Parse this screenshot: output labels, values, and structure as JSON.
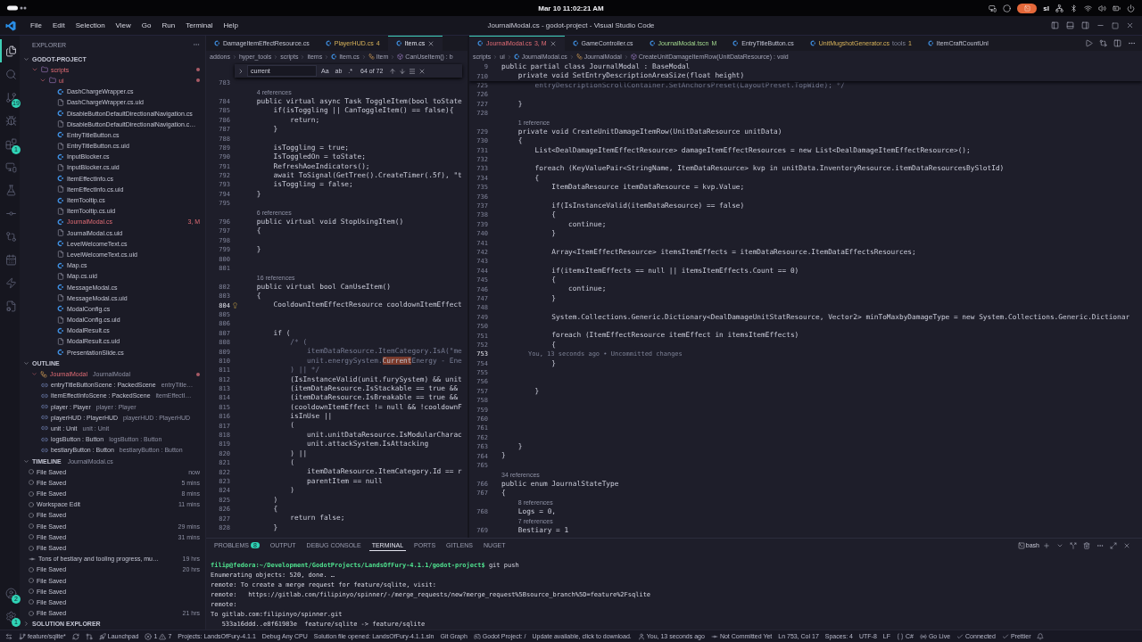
{
  "system_bar": {
    "datetime": "Mar 10  11:02:21 AM",
    "user": "sl"
  },
  "title_bar": {
    "menus": [
      "File",
      "Edit",
      "Selection",
      "View",
      "Go",
      "Run",
      "Terminal",
      "Help"
    ],
    "title": "JournalModal.cs - godot-project - Visual Studio Code"
  },
  "activity_bar": {
    "items": [
      {
        "selected": true
      },
      {
        "selected": false
      },
      {
        "selected": false,
        "badge": "19"
      },
      {
        "selected": false
      },
      {
        "selected": false,
        "badge": "1"
      },
      {
        "selected": false
      },
      {
        "selected": false
      },
      {
        "selected": false
      },
      {
        "selected": false
      },
      {
        "selected": false
      },
      {
        "selected": false
      },
      {
        "selected": false
      }
    ],
    "bottom": [
      {
        "badge": "2"
      },
      {
        "badge": "1"
      }
    ]
  },
  "sidebar": {
    "explorer": {
      "title": "EXPLORER",
      "project": "GODOT-PROJECT",
      "tree": [
        {
          "name": "scripts",
          "kind": "folder",
          "errored": true,
          "expanded": true,
          "children": [
            {
              "name": "ui",
              "kind": "folder",
              "errored": true,
              "expanded": true,
              "children": [
                {
                  "name": "DashChargeWrapper.cs",
                  "kind": "cs",
                  "errored": false
                },
                {
                  "name": "DashChargeWrapper.cs.uid",
                  "kind": "file",
                  "errored": false
                },
                {
                  "name": "DisableButtonDefaultDirectionalNavigation.cs",
                  "kind": "cs",
                  "errored": false
                },
                {
                  "name": "DisableButtonDefaultDirectionalNavigation.c…",
                  "kind": "file",
                  "errored": false
                },
                {
                  "name": "EntryTitleButton.cs",
                  "kind": "cs",
                  "errored": false
                },
                {
                  "name": "EntryTitleButton.cs.uid",
                  "kind": "file",
                  "errored": false
                },
                {
                  "name": "InputBlocker.cs",
                  "kind": "cs",
                  "errored": false
                },
                {
                  "name": "InputBlocker.cs.uid",
                  "kind": "file",
                  "errored": false
                },
                {
                  "name": "ItemEffectInfo.cs",
                  "kind": "cs",
                  "errored": false
                },
                {
                  "name": "ItemEffectInfo.cs.uid",
                  "kind": "file",
                  "errored": false
                },
                {
                  "name": "ItemTooltip.cs",
                  "kind": "cs",
                  "errored": false
                },
                {
                  "name": "ItemTooltip.cs.uid",
                  "kind": "file",
                  "errored": false
                },
                {
                  "name": "JournalModal.cs",
                  "kind": "cs",
                  "errored": true,
                  "badge": "3, M"
                },
                {
                  "name": "JournalModal.cs.uid",
                  "kind": "file",
                  "errored": false
                },
                {
                  "name": "LevelWelcomeText.cs",
                  "kind": "cs",
                  "errored": false
                },
                {
                  "name": "LevelWelcomeText.cs.uid",
                  "kind": "file",
                  "errored": false
                },
                {
                  "name": "Map.cs",
                  "kind": "cs",
                  "errored": false
                },
                {
                  "name": "Map.cs.uid",
                  "kind": "file",
                  "errored": false
                },
                {
                  "name": "MessageModal.cs",
                  "kind": "cs",
                  "errored": false
                },
                {
                  "name": "MessageModal.cs.uid",
                  "kind": "file",
                  "errored": false
                },
                {
                  "name": "ModalConfig.cs",
                  "kind": "cs",
                  "errored": false
                },
                {
                  "name": "ModalConfig.cs.uid",
                  "kind": "file",
                  "errored": false
                },
                {
                  "name": "ModalResult.cs",
                  "kind": "cs",
                  "errored": false
                },
                {
                  "name": "ModalResult.cs.uid",
                  "kind": "file",
                  "errored": false
                },
                {
                  "name": "PresentationSlide.cs",
                  "kind": "cs",
                  "errored": false
                }
              ]
            }
          ]
        }
      ]
    },
    "outline": {
      "title": "OUTLINE",
      "expanded": true,
      "root": {
        "name": "JournalModal",
        "detail": "JournalModal",
        "expanded": true,
        "children": [
          {
            "name": "entryTitleButtonScene : PackedScene",
            "detail": "entryTitle…"
          },
          {
            "name": "itemEffectInfoScene : PackedScene",
            "detail": "itemEffectI…"
          },
          {
            "name": "player : Player",
            "detail": "player : Player"
          },
          {
            "name": "playerHUD : PlayerHUD",
            "detail": "playerHUD : PlayerHUD"
          },
          {
            "name": "unit : Unit",
            "detail": "unit : Unit"
          },
          {
            "name": "logsButton : Button",
            "detail": "logsButton : Button"
          },
          {
            "name": "bestiaryButton : Button",
            "detail": "bestiaryButton : Button"
          }
        ]
      }
    },
    "timeline": {
      "title": "TIMELINE",
      "file": "JournalModal.cs",
      "expanded": true,
      "entries": [
        {
          "label": "File Saved",
          "time": "now",
          "kind": "save"
        },
        {
          "label": "File Saved",
          "time": "5 mins",
          "kind": "save"
        },
        {
          "label": "File Saved",
          "time": "8 mins",
          "kind": "save"
        },
        {
          "label": "Workspace Edit",
          "time": "11 mins",
          "kind": "save"
        },
        {
          "label": "File Saved",
          "kind": "save"
        },
        {
          "label": "File Saved",
          "time": "29 mins",
          "kind": "save"
        },
        {
          "label": "File Saved",
          "time": "31 mins",
          "kind": "save"
        },
        {
          "label": "File Saved",
          "kind": "save"
        },
        {
          "label": "Tons of bestiary and tooling progress, mu…",
          "time": "19 hrs",
          "kind": "commit"
        },
        {
          "label": "File Saved",
          "time": "20 hrs",
          "kind": "save"
        },
        {
          "label": "File Saved",
          "kind": "save"
        },
        {
          "label": "File Saved",
          "kind": "save"
        },
        {
          "label": "File Saved",
          "kind": "save"
        },
        {
          "label": "File Saved",
          "time": "21 hrs",
          "kind": "save"
        }
      ]
    },
    "solution_explorer": {
      "title": "SOLUTION EXPLORER",
      "expanded": false
    }
  },
  "editors": [
    {
      "tabs": [
        {
          "label": "DamageItemEffectResource.cs",
          "kind": "plain",
          "selected": false
        },
        {
          "label": "PlayerHUD.cs",
          "badge": "4",
          "kind": "warning",
          "selected": false
        },
        {
          "label": "Item.cs",
          "kind": "plain",
          "selected": true
        }
      ],
      "breadcrumb": [
        {
          "text": "addons",
          "kind": "folder"
        },
        {
          "text": "hyper_tools",
          "kind": "folder"
        },
        {
          "text": "scripts",
          "kind": "folder"
        },
        {
          "text": "items",
          "kind": "folder"
        },
        {
          "text": "Item.cs",
          "kind": "cs"
        },
        {
          "text": "Item",
          "kind": "class"
        },
        {
          "text": "CanUseItem() : b",
          "kind": "method"
        }
      ],
      "find": {
        "value": "current",
        "options": [
          "Aa",
          "ab",
          ".*"
        ],
        "count": "64 of 72"
      },
      "lines": [
        {
          "n": "783",
          "current": false
        },
        {
          "n": "784",
          "text": "    public virtual async Task ToggleItem(bool toState",
          "kind": "code",
          "current": false,
          "refs": "4 references"
        },
        {
          "n": "785",
          "text": "        if(isToggling || CanToggleItem() == false){",
          "kind": "code",
          "current": false
        },
        {
          "n": "786",
          "text": "            return;",
          "kind": "code",
          "current": false
        },
        {
          "n": "787",
          "text": "        }",
          "kind": "code",
          "current": false
        },
        {
          "n": "788",
          "current": false
        },
        {
          "n": "789",
          "text": "        isToggling = true;",
          "kind": "code",
          "current": false
        },
        {
          "n": "790",
          "text": "        IsToggledOn = toState;",
          "kind": "code",
          "current": false
        },
        {
          "n": "791",
          "text": "        RefreshAoeIndicators();",
          "kind": "code",
          "current": false
        },
        {
          "n": "792",
          "text": "        await ToSignal(GetTree().CreateTimer(.5f), \"t",
          "kind": "code",
          "current": false
        },
        {
          "n": "793",
          "text": "        isToggling = false;",
          "kind": "code",
          "current": false
        },
        {
          "n": "794",
          "text": "    }",
          "kind": "code",
          "current": false
        },
        {
          "n": "795",
          "current": false
        },
        {
          "n": "796",
          "text": "    public virtual void StopUsingItem()",
          "kind": "code",
          "current": false,
          "refs": "6 references"
        },
        {
          "n": "797",
          "text": "    {",
          "kind": "code",
          "current": false
        },
        {
          "n": "798",
          "current": false
        },
        {
          "n": "799",
          "text": "    }",
          "kind": "code",
          "current": false
        },
        {
          "n": "800",
          "current": false
        },
        {
          "n": "801",
          "current": false
        },
        {
          "n": "802",
          "text": "    public virtual bool CanUseItem()",
          "kind": "code",
          "current": false,
          "refs": "16 references"
        },
        {
          "n": "803",
          "text": "    {",
          "kind": "code",
          "current": false
        },
        {
          "n": "804",
          "text": "        CooldownItemEffectResource cooldownItemEffect",
          "kind": "code",
          "current": true,
          "quick_fix": true
        },
        {
          "n": "805",
          "current": false
        },
        {
          "n": "806",
          "current": false
        },
        {
          "n": "807",
          "text": "        if (",
          "kind": "code",
          "current": false
        },
        {
          "n": "808",
          "text": "            /* (",
          "kind": "comment",
          "current": false
        },
        {
          "n": "809",
          "text": "                itemDataResource.ItemCategory.IsA(\"me",
          "kind": "comment",
          "current": false
        },
        {
          "n": "810",
          "text": "                unit.energySystem.",
          "match": "Current",
          "after": "Energy - Ene",
          "kind": "comment",
          "current": false
        },
        {
          "n": "811",
          "text": "            ) || */",
          "kind": "comment",
          "current": false
        },
        {
          "n": "812",
          "text": "            (IsInstanceValid(unit.furySystem) && unit",
          "kind": "code",
          "current": false
        },
        {
          "n": "813",
          "text": "            (itemDataResource.IsStackable == true &&",
          "kind": "code",
          "current": false
        },
        {
          "n": "814",
          "text": "            (itemDataResource.IsBreakable == true &&",
          "kind": "code",
          "current": false
        },
        {
          "n": "815",
          "text": "            (cooldownItemEffect != null && !cooldownF",
          "kind": "code",
          "current": false
        },
        {
          "n": "816",
          "text": "            isInUse ||",
          "kind": "code",
          "current": false
        },
        {
          "n": "817",
          "text": "            (",
          "kind": "code",
          "current": false
        },
        {
          "n": "818",
          "text": "                unit.unitDataResource.IsModularCharac",
          "kind": "code",
          "current": false
        },
        {
          "n": "819",
          "text": "                unit.attackSystem.IsAttacking",
          "kind": "code",
          "current": false
        },
        {
          "n": "820",
          "text": "            ) ||",
          "kind": "code",
          "current": false
        },
        {
          "n": "821",
          "text": "            (",
          "kind": "code",
          "current": false
        },
        {
          "n": "822",
          "text": "                itemDataResource.ItemCategory.Id == r",
          "kind": "code",
          "current": false
        },
        {
          "n": "823",
          "text": "                parentItem == null",
          "kind": "code",
          "current": false
        },
        {
          "n": "824",
          "text": "            )",
          "kind": "code",
          "current": false
        },
        {
          "n": "825",
          "text": "        )",
          "kind": "code",
          "current": false
        },
        {
          "n": "826",
          "text": "        {",
          "kind": "code",
          "current": false
        },
        {
          "n": "827",
          "text": "            return false;",
          "kind": "code",
          "current": false
        },
        {
          "n": "828",
          "text": "        }",
          "kind": "code",
          "current": false
        }
      ]
    },
    {
      "tabs": [
        {
          "label": "JournalModal.cs",
          "badge": "3, M",
          "kind": "error",
          "selected": true
        },
        {
          "label": "GameController.cs",
          "kind": "plain",
          "selected": false
        },
        {
          "label": "JournalModal.tscn",
          "badge": "M",
          "kind": "modified",
          "selected": false
        },
        {
          "label": "EntryTitleButton.cs",
          "kind": "plain",
          "selected": false
        },
        {
          "label": "UnitMugshotGenerator.cs",
          "detail": "tools",
          "badge": "1",
          "kind": "warning",
          "selected": false
        },
        {
          "label": "ItemCraftCountUnl",
          "kind": "plain",
          "selected": false
        }
      ],
      "breadcrumb": [
        {
          "text": "scripts",
          "kind": "folder"
        },
        {
          "text": "ui",
          "kind": "folder"
        },
        {
          "text": "JournalModal.cs",
          "kind": "cs"
        },
        {
          "text": "JournalModal",
          "kind": "class"
        },
        {
          "text": "CreateUnitDamageItemRow(UnitDataResource) : void",
          "kind": "method"
        }
      ],
      "sticky": [
        {
          "n": "9",
          "text": "public partial class JournalModal : BaseModal"
        },
        {
          "n": "710",
          "text": "    private void SetEntryDescriptionAreaSize(float height)"
        }
      ],
      "lines": [
        {
          "n": "725",
          "text": "        entryDescriptionScrollContainer.SetAnchorsPreset(LayoutPreset.TopWide); */",
          "kind": "comment",
          "current": false
        },
        {
          "n": "726",
          "current": false
        },
        {
          "n": "727",
          "text": "    }",
          "kind": "code",
          "current": false
        },
        {
          "n": "728",
          "current": false
        },
        {
          "n": "729",
          "text": "    private void CreateUnitDamageItemRow(UnitDataResource unitData)",
          "kind": "code",
          "current": false,
          "refs": "1 reference"
        },
        {
          "n": "730",
          "text": "    {",
          "kind": "code",
          "current": false
        },
        {
          "n": "731",
          "text": "        List<DealDamageItemEffectResource> damageItemEffectResources = new List<DealDamageItemEffectResource>();",
          "kind": "code",
          "current": false
        },
        {
          "n": "732",
          "current": false
        },
        {
          "n": "733",
          "text": "        foreach (KeyValuePair<StringName, ItemDataResource> kvp in unitData.InventoryResource.itemDataResourcesBySlotId)",
          "kind": "code",
          "current": false
        },
        {
          "n": "734",
          "text": "        {",
          "kind": "code",
          "current": false
        },
        {
          "n": "735",
          "text": "            ItemDataResource itemDataResource = kvp.Value;",
          "kind": "code",
          "current": false
        },
        {
          "n": "736",
          "current": false
        },
        {
          "n": "737",
          "text": "            if(IsInstanceValid(itemDataResource) == false)",
          "kind": "code",
          "current": false
        },
        {
          "n": "738",
          "text": "            {",
          "kind": "code",
          "current": false
        },
        {
          "n": "739",
          "text": "                continue;",
          "kind": "code",
          "current": false
        },
        {
          "n": "740",
          "text": "            }",
          "kind": "code",
          "current": false
        },
        {
          "n": "741",
          "current": false
        },
        {
          "n": "742",
          "text": "            Array<ItemEffectResource> itemsItemEffects = itemDataResource.ItemDataEffectsResources;",
          "kind": "code",
          "current": false
        },
        {
          "n": "743",
          "current": false
        },
        {
          "n": "744",
          "text": "            if(itemsItemEffects == null || itemsItemEffects.Count == 0)",
          "kind": "code",
          "current": false
        },
        {
          "n": "745",
          "text": "            {",
          "kind": "code",
          "current": false
        },
        {
          "n": "746",
          "text": "                continue;",
          "kind": "code",
          "current": false
        },
        {
          "n": "747",
          "text": "            }",
          "kind": "code",
          "current": false
        },
        {
          "n": "748",
          "current": false
        },
        {
          "n": "749",
          "text": "            System.Collections.Generic.Dictionary<DealDamageUnitStatResource, Vector2> minToMaxbyDamageType = new System.Collections.Generic.Dictionar",
          "kind": "code",
          "current": false
        },
        {
          "n": "750",
          "current": false
        },
        {
          "n": "751",
          "text": "            foreach (ItemEffectResource itemEffect in itemsItemEffects)",
          "kind": "code",
          "current": false
        },
        {
          "n": "752",
          "text": "            {",
          "kind": "code",
          "current": false
        },
        {
          "n": "753",
          "current": true,
          "blame": "You, 13 seconds ago • Uncommitted changes"
        },
        {
          "n": "754",
          "text": "            }",
          "kind": "code",
          "current": false
        },
        {
          "n": "755",
          "current": false
        },
        {
          "n": "756",
          "current": false
        },
        {
          "n": "757",
          "text": "        }",
          "kind": "code",
          "current": false
        },
        {
          "n": "758",
          "current": false
        },
        {
          "n": "759",
          "current": false
        },
        {
          "n": "760",
          "current": false
        },
        {
          "n": "761",
          "current": false
        },
        {
          "n": "762",
          "current": false
        },
        {
          "n": "763",
          "text": "    }",
          "kind": "code",
          "current": false
        },
        {
          "n": "764",
          "text": "}",
          "kind": "code",
          "current": false
        },
        {
          "n": "765",
          "current": false
        },
        {
          "n": "766",
          "text": "public enum JournalStateType",
          "kind": "code",
          "current": false,
          "refs": "34 references"
        },
        {
          "n": "767",
          "text": "{",
          "kind": "code",
          "current": false
        },
        {
          "n": "768",
          "text": "    Logs = 0,",
          "kind": "code",
          "current": false,
          "refs": "8 references"
        },
        {
          "n": "769",
          "text": "    Bestiary = 1",
          "kind": "code",
          "current": false,
          "refs": "7 references"
        }
      ]
    }
  ],
  "panel": {
    "tabs": [
      {
        "label": "PROBLEMS",
        "badge": "8",
        "selected": false
      },
      {
        "label": "OUTPUT",
        "selected": false
      },
      {
        "label": "DEBUG CONSOLE",
        "selected": false
      },
      {
        "label": "TERMINAL",
        "selected": true
      },
      {
        "label": "PORTS",
        "selected": false
      },
      {
        "label": "GITLENS",
        "selected": false
      },
      {
        "label": "NUGET",
        "selected": false
      }
    ],
    "shell": "bash",
    "prompt": "filip@fedora:~/Development/GodotProjects/LandsOfFury-4.1.1/godot-project$",
    "command": "git push",
    "output": [
      "Enumerating objects: 520, done. …",
      "remote: To create a merge request for feature/sqlite, visit:",
      "remote:   https://gitlab.com/filipinyo/spinner/-/merge_requests/new?merge_request%5Bsource_branch%5D=feature%2Fsqlite",
      "remote:",
      "To gitlab.com:filipinyo/spinner.git",
      "   533a16ddd..e8f61983e  feature/sqlite -> feature/sqlite"
    ]
  },
  "status_bar": [
    {
      "kind": "remote"
    },
    {
      "kind": "branch",
      "text": "feature/sqlite*"
    },
    {
      "kind": "sync"
    },
    {
      "kind": "pr"
    },
    {
      "kind": "launchpad",
      "text": "Launchpad"
    },
    {
      "kind": "problems",
      "errors": "1",
      "warnings": "7"
    },
    {
      "kind": "text",
      "text": "Projects: LandsOfFury-4.1.1"
    },
    {
      "kind": "text",
      "text": "Debug Any CPU"
    },
    {
      "kind": "text",
      "text": "Solution file opened: LandsOfFury-4.1.1.sln"
    },
    {
      "kind": "text",
      "text": "Git Graph"
    },
    {
      "kind": "godot",
      "text": "Godot Project: /"
    },
    {
      "kind": "text",
      "text": "Update available, click to download."
    },
    {
      "kind": "person",
      "text": "You, 13 seconds ago"
    },
    {
      "kind": "commit",
      "text": "Not Committed Yet"
    },
    {
      "kind": "text",
      "text": "Ln 753, Col 17"
    },
    {
      "kind": "text",
      "text": "Spaces: 4"
    },
    {
      "kind": "text",
      "text": "UTF-8"
    },
    {
      "kind": "text",
      "text": "LF"
    },
    {
      "kind": "braces",
      "text": "C#"
    },
    {
      "kind": "live",
      "text": "Go Live"
    },
    {
      "kind": "check",
      "text": "Connected"
    },
    {
      "kind": "check",
      "text": "Prettier"
    },
    {
      "kind": "bell"
    }
  ]
}
